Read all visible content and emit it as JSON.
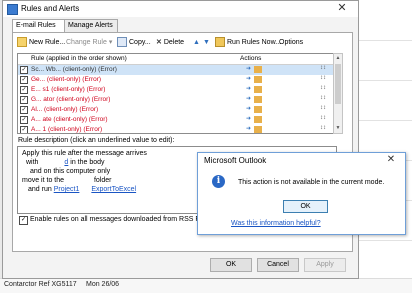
{
  "dialog": {
    "title": "Rules and Alerts",
    "close": "✕",
    "tabs": [
      {
        "label": "E-mail Rules",
        "active": true
      },
      {
        "label": "Manage Alerts",
        "active": false
      }
    ],
    "toolbar": {
      "new_rule": "New Rule...",
      "change_rule": "Change Rule",
      "copy": "Copy...",
      "delete": "Delete",
      "run_rules_now": "Run Rules Now...",
      "options": "Options"
    },
    "rules_header": {
      "name": "Rule (applied in the order shown)",
      "actions": "Actions"
    },
    "rules": [
      {
        "name": "Sc... Wb... (client-only)  (Error)",
        "checked": true,
        "selected": true
      },
      {
        "name": "Ge... (client-only)  (Error)",
        "checked": true,
        "selected": false
      },
      {
        "name": "E... s1 (client-only)  (Error)",
        "checked": true,
        "selected": false
      },
      {
        "name": "G... ator  (client-only)  (Error)",
        "checked": true,
        "selected": false
      },
      {
        "name": "Al... (client-only)  (Error)",
        "checked": true,
        "selected": false
      },
      {
        "name": "A... ate (client-only)  (Error)",
        "checked": true,
        "selected": false
      },
      {
        "name": "A... 1 (client-only)  (Error)",
        "checked": true,
        "selected": false
      }
    ],
    "description_label": "Rule description (click an underlined value to edit):",
    "description": {
      "line1": "Apply this rule after the message arrives",
      "line2_pre": "with",
      "line2_link": "d",
      "line2_post": "in the body",
      "line3": "and on this computer only",
      "line4_pre": "move it to the",
      "line4_link": "",
      "line4_post": "folder",
      "line5_pre": "and run",
      "line5_link1": "Project1",
      "line5_link2": "ExportToExcel"
    },
    "rss_label": "Enable rules on all messages downloaded from RSS Feeds",
    "rss_checked": true,
    "buttons": {
      "ok": "OK",
      "cancel": "Cancel",
      "apply": "Apply"
    }
  },
  "message_box": {
    "title": "Microsoft Outlook",
    "close": "✕",
    "icon": "information-icon",
    "icon_glyph": "i",
    "text": "This action is not available in the current mode.",
    "ok": "OK",
    "link": "Was this information helpful?"
  },
  "background": {
    "status_left": "Contarctor Ref  XG5117",
    "status_date": "Mon 26/06"
  },
  "colors": {
    "error_text": "#d0021b",
    "link": "#1a55c4",
    "selection": "#cfe3f7"
  }
}
